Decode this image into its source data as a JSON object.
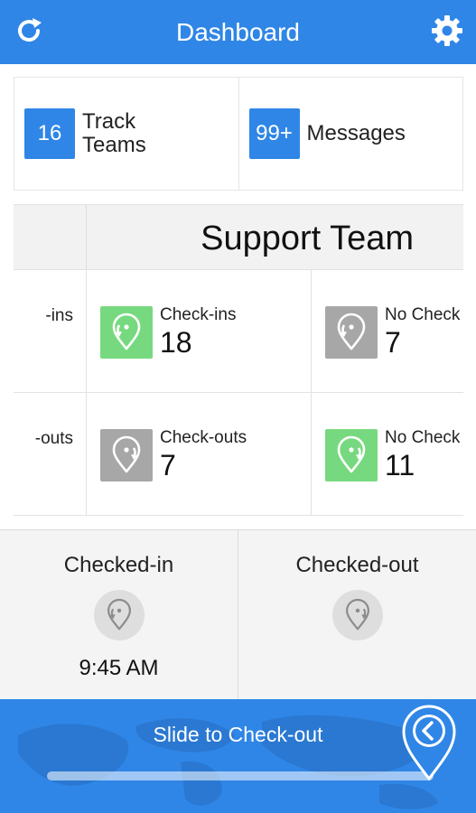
{
  "header": {
    "title": "Dashboard",
    "refresh_icon": "refresh-icon",
    "settings_icon": "gear-icon"
  },
  "top_cards": [
    {
      "badge": "16",
      "label_line1": "Track",
      "label_line2": "Teams"
    },
    {
      "badge": "99+",
      "label": "Messages"
    }
  ],
  "team": {
    "name": "Support Team",
    "left_partial": {
      "row1": "-ins",
      "row2": "-outs"
    },
    "stats": [
      {
        "label": "Check-ins",
        "value": "18",
        "icon": "location-checkin-icon",
        "color": "green"
      },
      {
        "label": "No Check",
        "value": "7",
        "icon": "location-checkin-icon",
        "color": "gray"
      },
      {
        "label": "Check-outs",
        "value": "7",
        "icon": "location-checkout-icon",
        "color": "gray"
      },
      {
        "label": "No Check",
        "value": "11",
        "icon": "location-checkout-icon",
        "color": "green"
      }
    ]
  },
  "status": {
    "checked_in": {
      "title": "Checked-in",
      "time": "9:45 AM"
    },
    "checked_out": {
      "title": "Checked-out",
      "time": ""
    }
  },
  "slider": {
    "text": "Slide to Check-out"
  },
  "colors": {
    "primary": "#2f86e6",
    "green": "#77d97f",
    "gray": "#a7a7a7"
  }
}
